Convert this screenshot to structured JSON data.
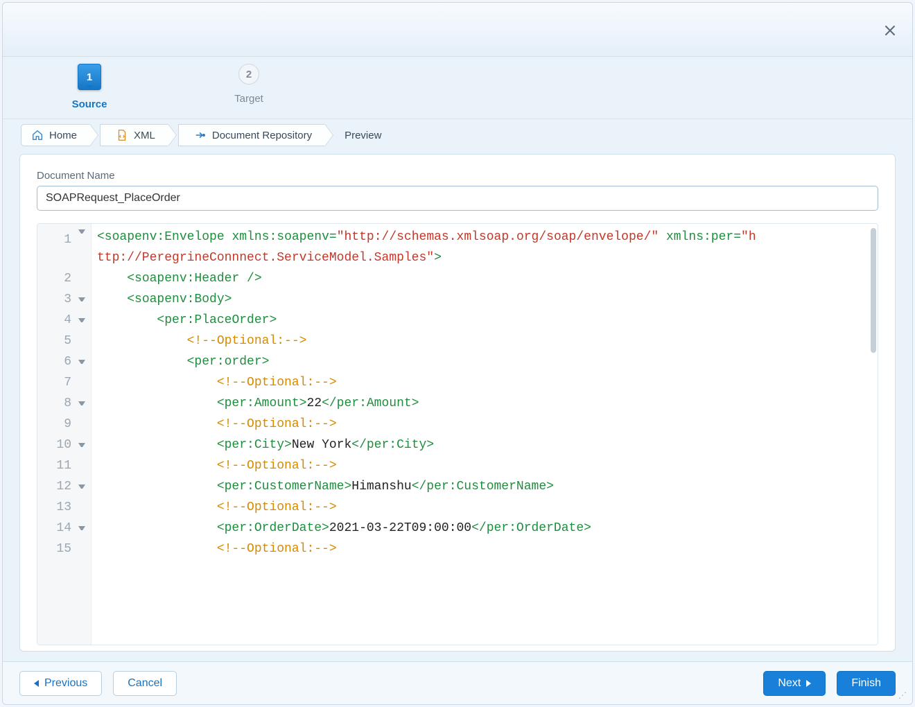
{
  "colors": {
    "accent": "#1880d8"
  },
  "steps": [
    {
      "num": "1",
      "label": "Source",
      "active": true
    },
    {
      "num": "2",
      "label": "Target",
      "active": false
    }
  ],
  "breadcrumb": {
    "items": [
      {
        "label": "Home",
        "icon": "home-icon"
      },
      {
        "label": "XML",
        "icon": "file-code-icon"
      },
      {
        "label": "Document Repository",
        "icon": "repo-arrow-icon"
      }
    ],
    "tail": "Preview"
  },
  "form": {
    "document_name_label": "Document Name",
    "document_name_value": "SOAPRequest_PlaceOrder"
  },
  "code": {
    "lines": [
      {
        "n": 1,
        "fold": true,
        "indent": 0,
        "segments": [
          {
            "c": "t-tag",
            "t": "<soapenv:Envelope"
          },
          {
            "c": "t-txt",
            "t": " "
          },
          {
            "c": "t-attr",
            "t": "xmlns:soapenv"
          },
          {
            "c": "t-tag",
            "t": "="
          },
          {
            "c": "t-str",
            "t": "\"http://schemas.xmlsoap.org/soap/envelope/\""
          },
          {
            "c": "t-txt",
            "t": " "
          },
          {
            "c": "t-attr",
            "t": "xmlns:per"
          },
          {
            "c": "t-tag",
            "t": "="
          },
          {
            "c": "t-str",
            "t": "\"http://PeregrineConnnect.ServiceModel.Samples\""
          },
          {
            "c": "t-tag",
            "t": ">"
          }
        ],
        "wrap": true
      },
      {
        "n": 2,
        "fold": false,
        "indent": 1,
        "segments": [
          {
            "c": "t-tag",
            "t": "<soapenv:Header />"
          }
        ]
      },
      {
        "n": 3,
        "fold": true,
        "indent": 1,
        "segments": [
          {
            "c": "t-tag",
            "t": "<soapenv:Body>"
          }
        ]
      },
      {
        "n": 4,
        "fold": true,
        "indent": 2,
        "segments": [
          {
            "c": "t-tag",
            "t": "<per:PlaceOrder>"
          }
        ]
      },
      {
        "n": 5,
        "fold": false,
        "indent": 3,
        "segments": [
          {
            "c": "t-cmt",
            "t": "<!--Optional:-->"
          }
        ]
      },
      {
        "n": 6,
        "fold": true,
        "indent": 3,
        "segments": [
          {
            "c": "t-tag",
            "t": "<per:order>"
          }
        ]
      },
      {
        "n": 7,
        "fold": false,
        "indent": 4,
        "segments": [
          {
            "c": "t-cmt",
            "t": "<!--Optional:-->"
          }
        ]
      },
      {
        "n": 8,
        "fold": true,
        "indent": 4,
        "segments": [
          {
            "c": "t-tag",
            "t": "<per:Amount>"
          },
          {
            "c": "t-txt",
            "t": "22"
          },
          {
            "c": "t-tag",
            "t": "</per:Amount>"
          }
        ]
      },
      {
        "n": 9,
        "fold": false,
        "indent": 4,
        "segments": [
          {
            "c": "t-cmt",
            "t": "<!--Optional:-->"
          }
        ]
      },
      {
        "n": 10,
        "fold": true,
        "indent": 4,
        "segments": [
          {
            "c": "t-tag",
            "t": "<per:City>"
          },
          {
            "c": "t-txt",
            "t": "New York"
          },
          {
            "c": "t-tag",
            "t": "</per:City>"
          }
        ]
      },
      {
        "n": 11,
        "fold": false,
        "indent": 4,
        "segments": [
          {
            "c": "t-cmt",
            "t": "<!--Optional:-->"
          }
        ]
      },
      {
        "n": 12,
        "fold": true,
        "indent": 4,
        "segments": [
          {
            "c": "t-tag",
            "t": "<per:CustomerName>"
          },
          {
            "c": "t-txt",
            "t": "Himanshu"
          },
          {
            "c": "t-tag",
            "t": "</per:CustomerName>"
          }
        ]
      },
      {
        "n": 13,
        "fold": false,
        "indent": 4,
        "segments": [
          {
            "c": "t-cmt",
            "t": "<!--Optional:-->"
          }
        ]
      },
      {
        "n": 14,
        "fold": true,
        "indent": 4,
        "segments": [
          {
            "c": "t-tag",
            "t": "<per:OrderDate>"
          },
          {
            "c": "t-txt",
            "t": "2021-03-22T09:00:00"
          },
          {
            "c": "t-tag",
            "t": "</per:OrderDate>"
          }
        ]
      },
      {
        "n": 15,
        "fold": false,
        "indent": 4,
        "segments": [
          {
            "c": "t-cmt",
            "t": "<!--Optional:-->"
          }
        ]
      }
    ]
  },
  "footer": {
    "previous": "Previous",
    "cancel": "Cancel",
    "next": "Next",
    "finish": "Finish"
  }
}
